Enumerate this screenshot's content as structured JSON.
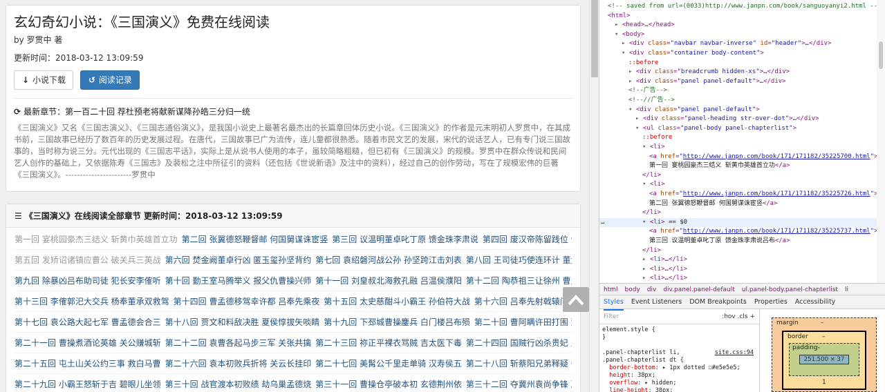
{
  "book": {
    "title": "玄幻奇幻小说：《三国演义》免费在线阅读",
    "author": "by 罗贯中 著",
    "updated": "更新时间：2018-03-12 13:09:59",
    "download_label": "小说下载",
    "history_label": "阅读记录",
    "latest_chapter": "最新章节：第一百二十回 荐杜预老将献新谋降孙皓三分归一统",
    "description": "《三国演义》又名《三国志演义》、《三国志通俗演义》，是我国小说史上最著名最杰出的长篇章回体历史小说。《三国演义》的作者是元末明初人罗贯中，在其成书前，三国故事已经历了数百年的历史发展过程。在唐代，三国故事已广为流传，连儿童都很熟悉。随着市民文艺的发展，宋代的说话艺人，已有专门说三国故事的，当时称为说三分。元代出现的《三国志平话》，实际上是从说书人使用的本子，虽较简略粗糙，但已初有《三国演义》的规模。罗贯中在群众传说和民间艺人创作的基础上，又依据陈寿《三国志》及裴松之注中所征引的资料（还包括《世说新语》及注中的资料），经过自己的创作劳动，写在了规模宏伟的巨著《三国演义》。-----------------------罗贯中"
  },
  "chapters": {
    "heading": "《三国演义》在线阅读全部章节 更新时间：2018-03-12 13:09:59",
    "rows": [
      [
        {
          "t": "第一回 宴桃园豪杰三结义 斩黄巾英雄首立功",
          "v": true
        },
        {
          "t": "第二回 张翼德怒鞭督邮 何国舅谋诛宦竖",
          "v": false
        },
        {
          "t": "第三回 议温明董卓叱丁原 馈金珠李肃说",
          "v": false
        },
        {
          "t": "第四回 废汉帝陈留践位 谋董贼孟德献刀",
          "v": false
        }
      ],
      [
        {
          "t": "第五回 发矫诏诸镇应曹公 破关兵三英战",
          "v": true
        },
        {
          "t": "第六回 焚金阙董卓行凶 匿玉玺孙坚背约",
          "v": false
        },
        {
          "t": "第七回 袁绍磐河战公孙 孙坚跨江击刘表",
          "v": false
        },
        {
          "t": "第八回 王司徒巧使连环计 董太师大闹凤",
          "v": false
        }
      ],
      [
        {
          "t": "第九回 除暴凶吕布助司徒 犯长安李傕听",
          "v": false
        },
        {
          "t": "第十回 勤王室马腾举义 报父仇曹操兴师",
          "v": false
        },
        {
          "t": "第十一回 刘皇叔北海救孔融 吕温侯濮阳",
          "v": false
        },
        {
          "t": "第十二回 陶恭祖三让徐州 曹孟德大战吕",
          "v": false
        }
      ],
      [
        {
          "t": "第十三回 李傕郭汜大交兵 杨奉董承双救驾",
          "v": false
        },
        {
          "t": "第十四回 曹孟德移驾幸许都 吕奉先乘夜",
          "v": false
        },
        {
          "t": "第十五回 太史慈酣斗小霸王 孙伯符大战",
          "v": false
        },
        {
          "t": "第十六回 吕奉先射戟辕门 曹孟德败师水",
          "v": false
        }
      ],
      [
        {
          "t": "第十七回 袁公路大起七军 曹孟德会合三",
          "v": false
        },
        {
          "t": "第十八回 贾文和料敌决胜 夏侯惇拔矢啖睛",
          "v": false
        },
        {
          "t": "第十九回 下邳城曹操鏖兵 白门楼吕布殒",
          "v": false
        },
        {
          "t": "第二十回 曹阿瞒许田打围 董国舅内阁受",
          "v": false
        }
      ],
      [
        {
          "t": "第二十一回 曹操煮酒论英雄 关公赚城斩",
          "v": false
        },
        {
          "t": "第二十二回 袁曹各起马步三军 关张共擒",
          "v": false
        },
        {
          "t": "第二十三回 祢正平裸衣骂贼 吉太医下毒",
          "v": false
        },
        {
          "t": "第二十四回 国贼行凶杀贵妃 皇叔败走投",
          "v": false
        }
      ],
      [
        {
          "t": "第二十五回 屯土山关公约三事 救白马曹",
          "v": false
        },
        {
          "t": "第二十六回 袁本初败兵折将 关云长挂印",
          "v": false
        },
        {
          "t": "第二十七回 美髯公千里走单骑 汉寿侯五",
          "v": false
        },
        {
          "t": "第二十八回 斩蔡阳兄弟释疑 会古城主臣",
          "v": false
        }
      ],
      [
        {
          "t": "第二十九回 小霸王怒斩于吉 碧眼儿坐领",
          "v": false
        },
        {
          "t": "第三十回 战官渡本初败绩 劫乌巢孟德烧",
          "v": false
        },
        {
          "t": "第三十一回 曹操仓亭破本初 玄德荆州依",
          "v": false
        },
        {
          "t": "第三十二回 夺冀州袁尚争锋 决漳河许攸",
          "v": false
        }
      ]
    ]
  },
  "devtools": {
    "dom_lines": [
      {
        "i": 0,
        "h": "<span class=\"cm\">&lt;!-- saved from url=(0033)http://www.janpn.com/book/sanguoyanyi2.html --&gt;</span>"
      },
      {
        "i": 0,
        "h": "<span class=\"t\">&lt;html&gt;</span>"
      },
      {
        "i": 1,
        "a": "▸",
        "h": "<span class=\"t\">&lt;head&gt;</span><span class=\"tx\">…</span><span class=\"t\">&lt;/head&gt;</span>"
      },
      {
        "i": 1,
        "a": "▾",
        "h": "<span class=\"t\">&lt;body&gt;</span>"
      },
      {
        "i": 2,
        "a": "▸",
        "h": "<span class=\"t\">&lt;div </span><span class=\"an\">class</span>=<span class=\"av\">\"navbar navbar-inverse\"</span> <span class=\"an\">id</span>=<span class=\"av\">\"header\"</span><span class=\"t\">&gt;</span><span class=\"tx\">…</span><span class=\"t\">&lt;/div&gt;</span>"
      },
      {
        "i": 2,
        "a": "▾",
        "h": "<span class=\"t\">&lt;div </span><span class=\"an\">class</span>=<span class=\"av\">\"container body-content\"</span><span class=\"t\">&gt;</span>"
      },
      {
        "i": 3,
        "h": "<span class=\"ps\">::before</span>"
      },
      {
        "i": 3,
        "a": "▸",
        "h": "<span class=\"t\">&lt;div </span><span class=\"an\">class</span>=<span class=\"av\">\"breadcrumb hidden-xs\"</span><span class=\"t\">&gt;</span><span class=\"tx\">…</span><span class=\"t\">&lt;/div&gt;</span>"
      },
      {
        "i": 3,
        "a": "▸",
        "h": "<span class=\"t\">&lt;div </span><span class=\"an\">class</span>=<span class=\"av\">\"panel panel-default\"</span><span class=\"t\">&gt;</span><span class=\"tx\">…</span><span class=\"t\">&lt;/div&gt;</span>"
      },
      {
        "i": 3,
        "h": "<span class=\"cm\">&lt;!--广告--&gt;</span>"
      },
      {
        "i": 3,
        "h": "<span class=\"cm\">&lt;!--//广告--&gt;</span>"
      },
      {
        "i": 3,
        "a": "▾",
        "h": "<span class=\"t\">&lt;div </span><span class=\"an\">class</span>=<span class=\"av\">\"panel panel-default\"</span><span class=\"t\">&gt;</span>"
      },
      {
        "i": 4,
        "a": "▸",
        "h": "<span class=\"t\">&lt;div </span><span class=\"an\">class</span>=<span class=\"av\">\"panel-heading str-over-dot\"</span><span class=\"t\">&gt;</span><span class=\"tx\">…</span><span class=\"t\">&lt;/div&gt;</span>"
      },
      {
        "i": 4,
        "a": "▾",
        "h": "<span class=\"t\">&lt;ul </span><span class=\"an\">class</span>=<span class=\"av\">\"panel-body panel-chapterlist\"</span><span class=\"t\">&gt;</span>"
      },
      {
        "i": 5,
        "h": "<span class=\"ps\">::before</span>"
      },
      {
        "i": 5,
        "a": "▾",
        "h": "<span class=\"t\">&lt;li&gt;</span>"
      },
      {
        "i": 6,
        "h": "<span class=\"t\">&lt;a </span><span class=\"an\">href</span>=<span class=\"av\">\"<span class=\"lk\">http://www.janpn.com/book/171/171182/35225700.html</span>\"</span><span class=\"t\">&gt;</span>"
      },
      {
        "i": 6,
        "h": "<span class=\"tx\">第一回 宴桃园豪杰三结义 斩黄巾英雄首立功</span><span class=\"t\">&lt;/a&gt;</span>"
      },
      {
        "i": 5,
        "h": "<span class=\"t\">&lt;/li&gt;</span>"
      },
      {
        "i": 5,
        "a": "▾",
        "h": "<span class=\"t\">&lt;li&gt;</span>"
      },
      {
        "i": 6,
        "h": "<span class=\"t\">&lt;a </span><span class=\"an\">href</span>=<span class=\"av\">\"<span class=\"lk\">http://www.janpn.com/book/171/171182/35225726.html</span>\"</span><span class=\"t\">&gt;</span>"
      },
      {
        "i": 6,
        "h": "<span class=\"tx\">第二回 张翼德怒鞭督邮 何国舅谋诛宦竖</span><span class=\"t\">&lt;/a&gt;</span>"
      },
      {
        "i": 5,
        "h": "<span class=\"t\">&lt;/li&gt;</span>"
      },
      {
        "i": 5,
        "a": "▾",
        "sel": true,
        "h": "<span class=\"t\">&lt;li&gt;</span><span class=\"tx\"> == $0</span>"
      },
      {
        "i": 6,
        "h": "<span class=\"t\">&lt;a </span><span class=\"an\">href</span>=<span class=\"av\">\"<span class=\"lk\">http://www.janpn.com/book/171/171182/35225737.html</span>\"</span><span class=\"t\">&gt;</span>"
      },
      {
        "i": 6,
        "h": "<span class=\"tx\">第三回 议温明董卓叱丁原 馈金珠李肃说吕布</span><span class=\"t\">&lt;/a&gt;</span>"
      },
      {
        "i": 5,
        "h": "<span class=\"t\">&lt;/li&gt;</span>"
      },
      {
        "i": 5,
        "a": "▸",
        "h": "<span class=\"t\">&lt;li&gt;</span><span class=\"tx\">…</span><span class=\"t\">&lt;/li&gt;</span>"
      },
      {
        "i": 5,
        "a": "▸",
        "h": "<span class=\"t\">&lt;li&gt;</span><span class=\"tx\">…</span><span class=\"t\">&lt;/li&gt;</span>"
      },
      {
        "i": 5,
        "a": "▸",
        "h": "<span class=\"t\">&lt;li&gt;</span><span class=\"tx\">…</span><span class=\"t\">&lt;/li&gt;</span>"
      }
    ],
    "breadcrumbs": [
      "html",
      "body",
      "div",
      "div.panel.panel-default",
      "ul.panel-body.panel-chapterlist",
      "li"
    ],
    "tabs": [
      "Styles",
      "Event Listeners",
      "DOM Breakpoints",
      "Properties",
      "Accessibility"
    ],
    "filter_placeholder": "Filter",
    "filter_tools": ":hov  .cls  +",
    "style_lines": [
      {
        "h": "<span class=\"sel\">element.style {</span>"
      },
      {
        "h": "<span class=\"sel\">}</span>"
      },
      {
        "h": ""
      },
      {
        "h": "<span class=\"sel\">.panel-chapterlist li,</span><span class=\"src\">site.css:94</span>"
      },
      {
        "h": "<span class=\"sel\">.panel-chapterlist dt {</span>"
      },
      {
        "h": "&nbsp;&nbsp;<span class=\"pn\">border-bottom</span>: <span class=\"pv\">▸ 1px dotted ☐#e5e5e5;</span>"
      },
      {
        "h": "&nbsp;&nbsp;<span class=\"pn\">height</span>: <span class=\"pv\">38px;</span>"
      },
      {
        "h": "&nbsp;&nbsp;<span class=\"pn\">overflow</span>: <span class=\"pv\">▸ hidden;</span>"
      },
      {
        "h": "&nbsp;&nbsp;<span class=\"pn\">line-height</span>: <span class=\"pv\">38px;</span>"
      }
    ],
    "box": {
      "margin": "margin",
      "margin_val": "–",
      "border": "border",
      "border_val": "–",
      "padding": "padding-",
      "content": "251.500 × 37",
      "bottom_val": "1"
    }
  },
  "colors": {
    "primary": "#337ab7",
    "link": "#23527c",
    "visited": "#999999",
    "panel_bg": "#ffffff"
  }
}
